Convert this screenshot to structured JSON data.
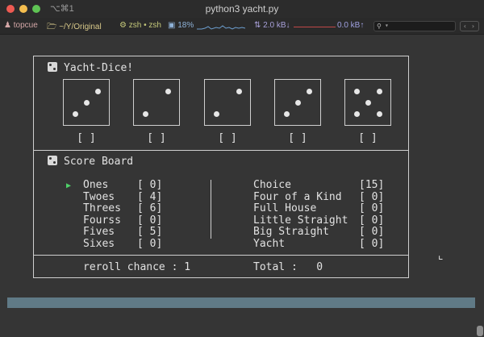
{
  "window": {
    "title": "python3 yacht.py",
    "shortcut": "⌥⌘1"
  },
  "statusbar": {
    "user": "topcue",
    "directory": "~/Y/Original",
    "shell": "zsh • zsh",
    "cpu": "18%",
    "net_down": "2.0 kB↓",
    "net_up": "0.0 kB↑",
    "search_placeholder": "",
    "icons": [
      "user-icon",
      "folder-icon",
      "shell-icon",
      "cpu-icon",
      "network-icon",
      "search-icon"
    ]
  },
  "game": {
    "title": "Yacht-Dice!",
    "dice": [
      {
        "value": 3,
        "hold": "[ ]"
      },
      {
        "value": 2,
        "hold": "[ ]"
      },
      {
        "value": 2,
        "hold": "[ ]"
      },
      {
        "value": 3,
        "hold": "[ ]"
      },
      {
        "value": 5,
        "hold": "[ ]"
      }
    ],
    "scoreboard_title": "Score Board",
    "cursor": "▶",
    "upper": [
      {
        "name": "Ones",
        "score": "[ 0]"
      },
      {
        "name": "Twoes",
        "score": "[ 4]"
      },
      {
        "name": "Threes",
        "score": "[ 6]"
      },
      {
        "name": "Fourss",
        "score": "[ 0]"
      },
      {
        "name": "Fives",
        "score": "[ 5]"
      },
      {
        "name": "Sixes",
        "score": "[ 0]"
      }
    ],
    "lower": [
      {
        "name": "Choice",
        "score": "[15]"
      },
      {
        "name": "Four of a Kind",
        "score": "[ 0]"
      },
      {
        "name": "Full House",
        "score": "[ 0]"
      },
      {
        "name": "Little Straight",
        "score": "[ 0]"
      },
      {
        "name": "Big Straight",
        "score": "[ 0]"
      },
      {
        "name": "Yacht",
        "score": "[ 0]"
      }
    ],
    "reroll_label": "reroll chance : 1",
    "total_label": "Total :   0"
  },
  "colors": {
    "background": "#353535",
    "border": "#cfcfcf",
    "cursor": "#4fd36a",
    "bottom_bar": "#607a86"
  }
}
